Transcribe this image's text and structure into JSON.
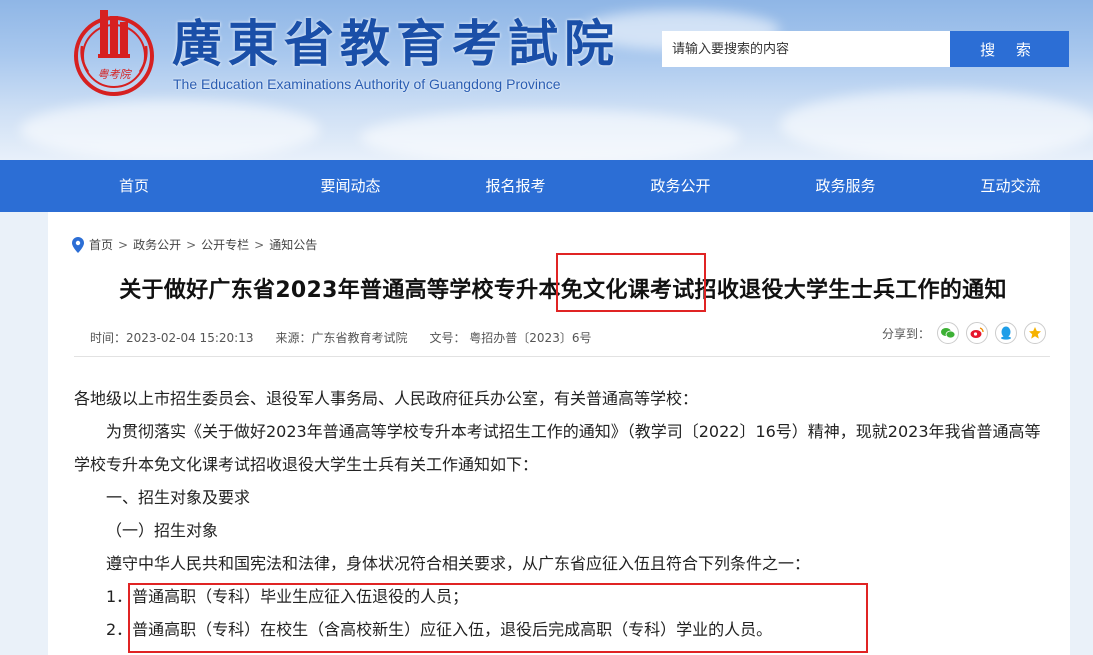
{
  "header": {
    "logo_seal_text": "粤考院",
    "title_cn": "廣東省教育考試院",
    "title_en": "The Education Examinations Authority of Guangdong Province"
  },
  "search": {
    "placeholder": "请输入要搜索的内容",
    "button_label": "搜 索"
  },
  "nav": {
    "items": [
      "首页",
      "要闻动态",
      "报名报考",
      "政务公开",
      "政务服务",
      "互动交流"
    ]
  },
  "breadcrumb": {
    "items": [
      "首页",
      "政务公开",
      "公开专栏",
      "通知公告"
    ],
    "separator": ">"
  },
  "article": {
    "title": "关于做好广东省2023年普通高等学校专升本免文化课考试招收退役大学生士兵工作的通知",
    "time": "时间：2023-02-04 15:20:13",
    "source": "来源：广东省教育考试院",
    "doc_no": "文号： 粤招办普〔2023〕6号",
    "share_label": "分享到：",
    "share_icons": [
      "wechat-icon",
      "weibo-icon",
      "qq-icon",
      "qzone-icon"
    ],
    "paragraphs": [
      "各地级以上市招生委员会、退役军人事务局、人民政府征兵办公室，有关普通高等学校：",
      "为贯彻落实《关于做好2023年普通高等学校专升本考试招生工作的通知》（教学司〔2022〕16号）精神，现就2023年我省普通高等学校专升本免文化课考试招收退役大学生士兵有关工作通知如下：",
      "一、招生对象及要求",
      "（一）招生对象",
      "遵守中华人民共和国宪法和法律，身体状况符合相关要求，从广东省应征入伍且符合下列条件之一：",
      "1．普通高职（专科）毕业生应征入伍退役的人员；",
      "2．普通高职（专科）在校生（含高校新生）应征入伍，退役后完成高职（专科）学业的人员。"
    ]
  },
  "colors": {
    "nav_bg": "#2c6ed5",
    "highlight": "#e02424",
    "title_blue": "#1a4fa8"
  }
}
